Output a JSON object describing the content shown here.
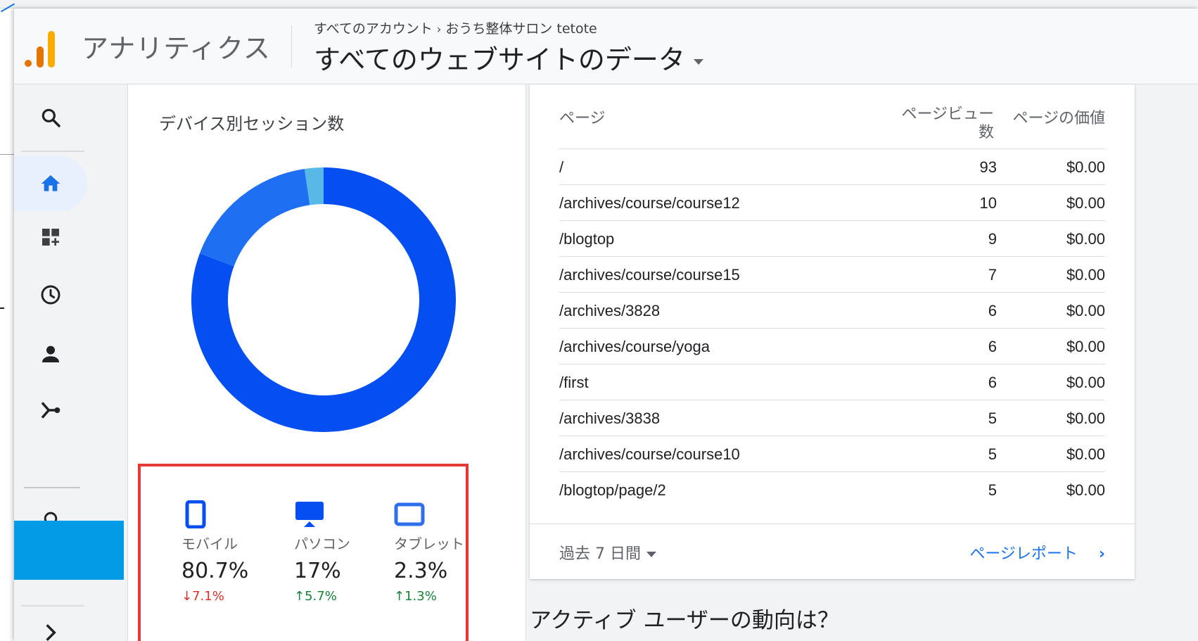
{
  "header": {
    "product_name": "アナリティクス",
    "breadcrumb": [
      "すべてのアカウント",
      "おうち整体サロン tetote"
    ],
    "view_title": "すべてのウェブサイトのデータ"
  },
  "sidenav": {
    "items": [
      "search-icon",
      "home-icon",
      "customization-icon",
      "realtime-icon",
      "audience-icon",
      "acquisition-icon",
      "insights-icon",
      "expand-icon"
    ],
    "active": "home-icon"
  },
  "device_card": {
    "title": "デバイス別セッション数",
    "devices": [
      {
        "label": "モバイル",
        "percent": "80.7%",
        "change": "7.1%",
        "direction": "down",
        "color": "#054ef2",
        "share": 80.7
      },
      {
        "label": "パソコン",
        "percent": "17%",
        "change": "5.7%",
        "direction": "up",
        "color": "#1e6ff1",
        "share": 17
      },
      {
        "label": "タブレット",
        "percent": "2.3%",
        "change": "1.3%",
        "direction": "up",
        "color": "#58b8e6",
        "share": 2.3
      }
    ]
  },
  "pages_table": {
    "columns": [
      "ページ",
      "ページビュー数",
      "ページの価値"
    ],
    "rows": [
      {
        "page": "/",
        "views": "93",
        "value": "$0.00"
      },
      {
        "page": "/archives/course/course12",
        "views": "10",
        "value": "$0.00"
      },
      {
        "page": "/blogtop",
        "views": "9",
        "value": "$0.00"
      },
      {
        "page": "/archives/course/course15",
        "views": "7",
        "value": "$0.00"
      },
      {
        "page": "/archives/3828",
        "views": "6",
        "value": "$0.00"
      },
      {
        "page": "/archives/course/yoga",
        "views": "6",
        "value": "$0.00"
      },
      {
        "page": "/first",
        "views": "6",
        "value": "$0.00"
      },
      {
        "page": "/archives/3838",
        "views": "5",
        "value": "$0.00"
      },
      {
        "page": "/archives/course/course10",
        "views": "5",
        "value": "$0.00"
      },
      {
        "page": "/blogtop/page/2",
        "views": "5",
        "value": "$0.00"
      }
    ],
    "period": "過去 7 日間",
    "report_link": "ページレポート"
  },
  "section_title": "アクティブ ユーザーの動向は？"
}
